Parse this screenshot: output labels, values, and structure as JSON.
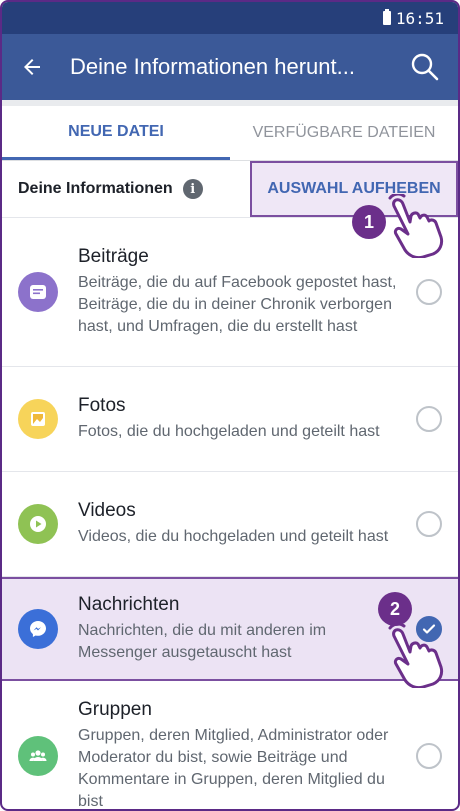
{
  "status_bar": {
    "time": "16:51"
  },
  "app_bar": {
    "title": "Deine Informationen herunt...",
    "back_icon": "arrow-left-icon",
    "search_icon": "search-icon"
  },
  "tabs": [
    {
      "label": "NEUE DATEI",
      "active": true
    },
    {
      "label": "VERFÜGBARE DATEIEN",
      "active": false
    }
  ],
  "info_section": {
    "label": "Deine Informationen",
    "info_glyph": "i",
    "deselect_label": "AUSWAHL AUFHEBEN"
  },
  "annotations": {
    "step1": "1",
    "step2": "2"
  },
  "items": [
    {
      "title": "Beiträge",
      "description": "Beiträge, die du auf Facebook gepostet hast, Beiträge, die du in deiner Chronik verborgen hast, und Umfragen, die du erstellt hast",
      "icon": "post-icon",
      "color": "#8c72cb",
      "checked": false
    },
    {
      "title": "Fotos",
      "description": "Fotos, die du hochgeladen und geteilt hast",
      "icon": "photo-icon",
      "color": "#f7d45a",
      "checked": false
    },
    {
      "title": "Videos",
      "description": "Videos, die du hochgeladen und geteilt hast",
      "icon": "video-play-icon",
      "color": "#8fc254",
      "checked": false
    },
    {
      "title": "Nachrichten",
      "description": "Nachrichten, die du mit anderen im Messenger ausgetauscht hast",
      "icon": "messenger-icon",
      "color": "#3b6fd8",
      "checked": true
    },
    {
      "title": "Gruppen",
      "description": "Gruppen, deren Mitglied, Administrator oder Moderator du bist, sowie Beiträge und Kommentare in Gruppen, deren Mitglied du bist",
      "icon": "groups-icon",
      "color": "#5fc17a",
      "checked": false
    }
  ],
  "colors": {
    "status_bar": "#263f7a",
    "app_bar": "#3b5998",
    "accent": "#4267b2",
    "highlight": "#7b4fa0"
  }
}
